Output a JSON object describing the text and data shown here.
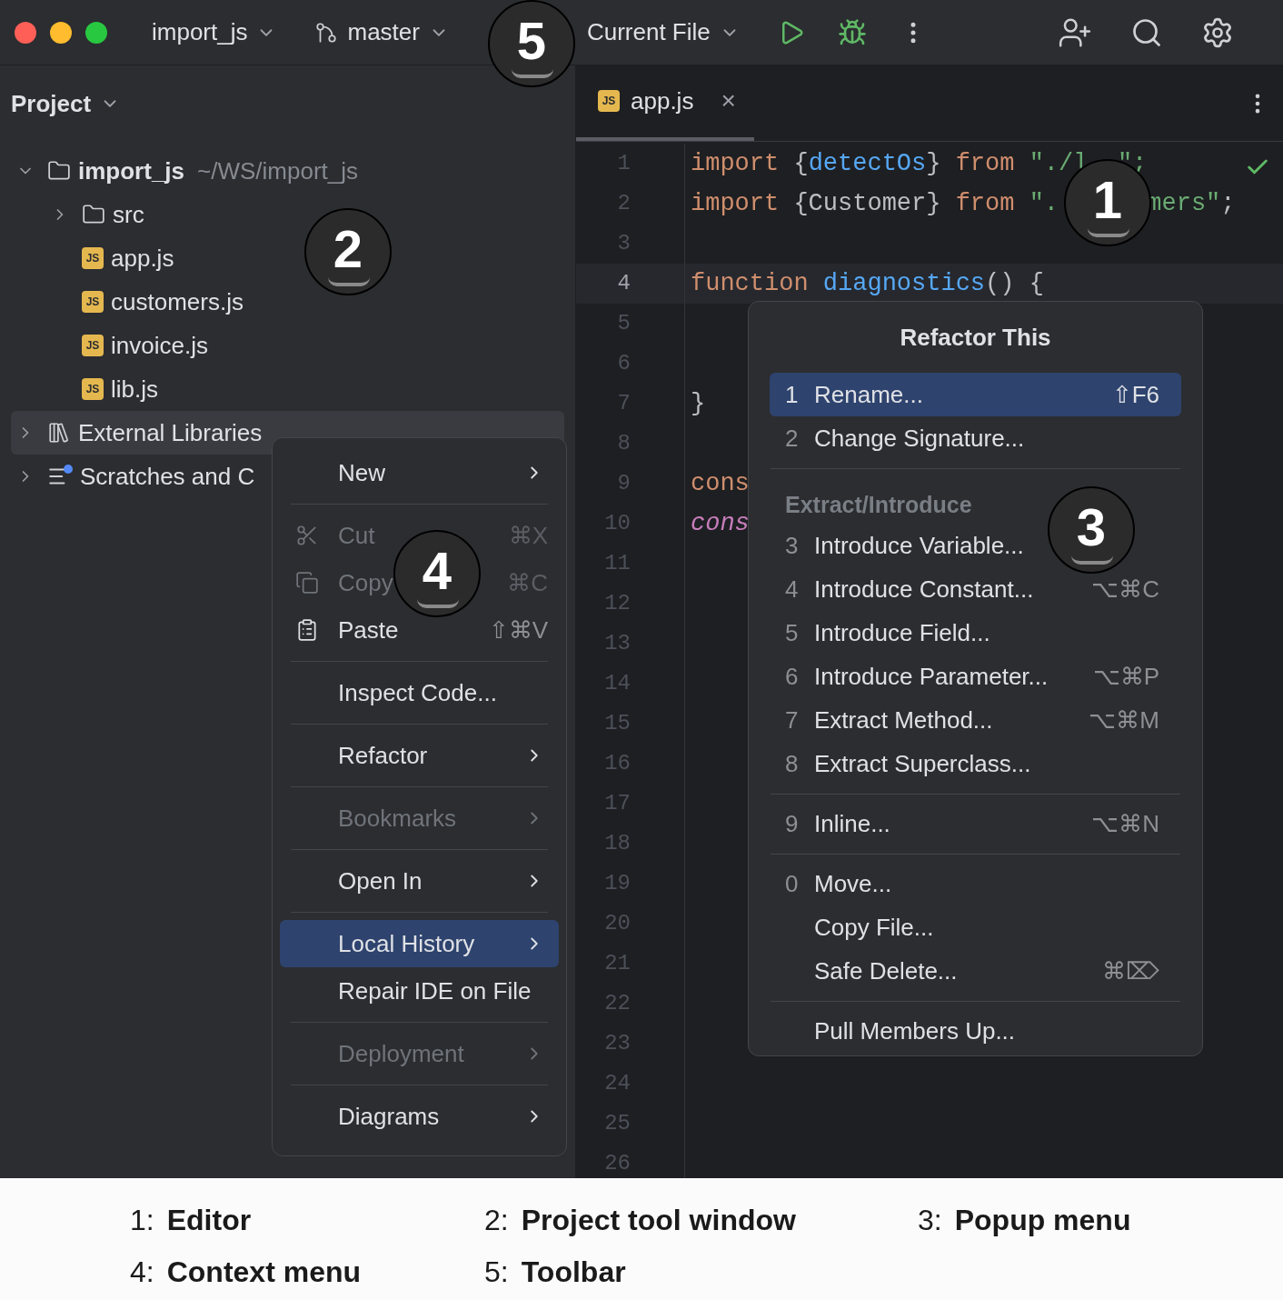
{
  "toolbar": {
    "project": "import_js",
    "branch": "master",
    "run_config": "Current File"
  },
  "project_panel": {
    "title": "Project",
    "tree": [
      {
        "label": "import_js",
        "hint": "~/WS/import_js",
        "kind": "folder",
        "expanded": true,
        "selected": false,
        "children": [
          {
            "label": "src",
            "kind": "folder",
            "expanded": false,
            "selected": false
          },
          {
            "label": "app.js",
            "kind": "js",
            "badge": "JS",
            "selected": false
          },
          {
            "label": "customers.js",
            "kind": "js",
            "badge": "JS",
            "selected": false
          },
          {
            "label": "invoice.js",
            "kind": "js",
            "badge": "JS",
            "selected": false
          },
          {
            "label": "lib.js",
            "kind": "js",
            "badge": "JS",
            "selected": false
          }
        ]
      },
      {
        "label": "External Libraries",
        "kind": "libraries",
        "expanded": false,
        "selected": true
      },
      {
        "label": "Scratches and C",
        "kind": "scratches",
        "expanded": false,
        "selected": false
      }
    ]
  },
  "editor": {
    "tabs": [
      {
        "label": "app.js",
        "badge": "JS",
        "selected": true,
        "close": "×"
      }
    ],
    "lines": [
      {
        "number": "1",
        "current": false,
        "segments": [
          {
            "text": "import ",
            "kind": "keyword"
          },
          {
            "text": "{",
            "kind": "plain"
          },
          {
            "text": "detectOs",
            "kind": "ident"
          },
          {
            "text": "} ",
            "kind": "plain"
          },
          {
            "text": "from ",
            "kind": "keyword"
          },
          {
            "text": "\"./l",
            "kind": "string"
          },
          {
            "text": "\";",
            "kind": "string",
            "after_gap": true
          }
        ]
      },
      {
        "number": "2",
        "current": false,
        "segments": [
          {
            "text": "import ",
            "kind": "keyword"
          },
          {
            "text": "{Customer} ",
            "kind": "plain"
          },
          {
            "text": "from ",
            "kind": "keyword"
          },
          {
            "text": "\".",
            "kind": "string"
          },
          {
            "text": "mers\"",
            "kind": "string",
            "after_gap": true
          },
          {
            "text": ";",
            "kind": "plain"
          }
        ]
      },
      {
        "number": "3",
        "current": false
      },
      {
        "number": "4",
        "current": true,
        "segments": [
          {
            "text": "function ",
            "kind": "keyword"
          },
          {
            "text": "diagnostics",
            "kind": "ident"
          },
          {
            "text": "() {",
            "kind": "plain"
          }
        ]
      },
      {
        "number": "5",
        "current": false
      },
      {
        "number": "6",
        "current": false
      },
      {
        "number": "7",
        "current": false,
        "segments": [
          {
            "text": "}",
            "kind": "plain"
          }
        ]
      },
      {
        "number": "8",
        "current": false
      },
      {
        "number": "9",
        "current": false,
        "segments": [
          {
            "text": "cons",
            "kind": "keyword"
          }
        ]
      },
      {
        "number": "10",
        "current": false,
        "segments": [
          {
            "text": "cons",
            "kind": "member"
          }
        ]
      },
      {
        "number": "11",
        "current": false
      },
      {
        "number": "12",
        "current": false
      },
      {
        "number": "13",
        "current": false
      },
      {
        "number": "14",
        "current": false
      },
      {
        "number": "15",
        "current": false
      },
      {
        "number": "16",
        "current": false
      },
      {
        "number": "17",
        "current": false
      },
      {
        "number": "18",
        "current": false
      },
      {
        "number": "19",
        "current": false
      },
      {
        "number": "20",
        "current": false
      },
      {
        "number": "21",
        "current": false
      },
      {
        "number": "22",
        "current": false
      },
      {
        "number": "23",
        "current": false
      },
      {
        "number": "24",
        "current": false
      },
      {
        "number": "25",
        "current": false
      },
      {
        "number": "26",
        "current": false
      }
    ]
  },
  "context_menu": {
    "items": [
      {
        "kind": "item",
        "label": "New",
        "submenu": true,
        "disabled": false,
        "selected": false
      },
      {
        "kind": "separator"
      },
      {
        "kind": "item",
        "label": "Cut",
        "shortcut": "⌘X",
        "submenu": false,
        "disabled": true,
        "selected": false
      },
      {
        "kind": "item",
        "label": "Copy",
        "shortcut": "⌘C",
        "submenu": false,
        "disabled": true,
        "selected": false
      },
      {
        "kind": "item",
        "label": "Paste",
        "shortcut": "⇧⌘V",
        "submenu": false,
        "disabled": false,
        "selected": false
      },
      {
        "kind": "separator"
      },
      {
        "kind": "item",
        "label": "Inspect Code...",
        "submenu": false,
        "disabled": false,
        "selected": false
      },
      {
        "kind": "separator"
      },
      {
        "kind": "item",
        "label": "Refactor",
        "submenu": true,
        "disabled": false,
        "selected": false
      },
      {
        "kind": "separator"
      },
      {
        "kind": "item",
        "label": "Bookmarks",
        "submenu": true,
        "disabled": true,
        "selected": false
      },
      {
        "kind": "separator"
      },
      {
        "kind": "item",
        "label": "Open In",
        "submenu": true,
        "disabled": false,
        "selected": false
      },
      {
        "kind": "separator"
      },
      {
        "kind": "item",
        "label": "Local History",
        "submenu": true,
        "disabled": false,
        "selected": true
      },
      {
        "kind": "item",
        "label": "Repair IDE on File",
        "submenu": false,
        "disabled": false,
        "selected": false
      },
      {
        "kind": "separator"
      },
      {
        "kind": "item",
        "label": "Deployment",
        "submenu": true,
        "disabled": true,
        "selected": false
      },
      {
        "kind": "separator"
      },
      {
        "kind": "item",
        "label": "Diagrams",
        "submenu": true,
        "disabled": false,
        "selected": false
      }
    ]
  },
  "popup_menu": {
    "title": "Refactor This",
    "items": [
      {
        "kind": "item",
        "number": "1",
        "label": "Rename...",
        "shortcut": "⇧F6",
        "selected": true
      },
      {
        "kind": "item",
        "number": "2",
        "label": "Change Signature...",
        "selected": false
      },
      {
        "kind": "separator"
      },
      {
        "kind": "header",
        "label": "Extract/Introduce"
      },
      {
        "kind": "item",
        "number": "3",
        "label": "Introduce Variable...",
        "selected": false
      },
      {
        "kind": "item",
        "number": "4",
        "label": "Introduce Constant...",
        "shortcut": "⌥⌘C",
        "selected": false
      },
      {
        "kind": "item",
        "number": "5",
        "label": "Introduce Field...",
        "selected": false
      },
      {
        "kind": "item",
        "number": "6",
        "label": "Introduce Parameter...",
        "shortcut": "⌥⌘P",
        "selected": false
      },
      {
        "kind": "item",
        "number": "7",
        "label": "Extract Method...",
        "shortcut": "⌥⌘M",
        "selected": false
      },
      {
        "kind": "item",
        "number": "8",
        "label": "Extract Superclass...",
        "selected": false
      },
      {
        "kind": "separator"
      },
      {
        "kind": "item",
        "number": "9",
        "label": "Inline...",
        "shortcut": "⌥⌘N",
        "selected": false
      },
      {
        "kind": "separator"
      },
      {
        "kind": "item",
        "number": "0",
        "label": "Move...",
        "selected": false
      },
      {
        "kind": "item",
        "label": "Copy File...",
        "selected": false
      },
      {
        "kind": "item",
        "label": "Safe Delete...",
        "shortcut": "⌘⌦",
        "selected": false
      },
      {
        "kind": "separator"
      },
      {
        "kind": "item",
        "label": "Pull Members Up...",
        "selected": false
      }
    ]
  },
  "callouts": [
    {
      "number": "1"
    },
    {
      "number": "2"
    },
    {
      "number": "3"
    },
    {
      "number": "4"
    },
    {
      "number": "5"
    }
  ],
  "legend": [
    {
      "number": "1:",
      "label": "Editor"
    },
    {
      "number": "2:",
      "label": "Project tool window"
    },
    {
      "number": "3:",
      "label": "Popup menu"
    },
    {
      "number": "4:",
      "label": "Context menu"
    },
    {
      "number": "5:",
      "label": "Toolbar"
    }
  ]
}
